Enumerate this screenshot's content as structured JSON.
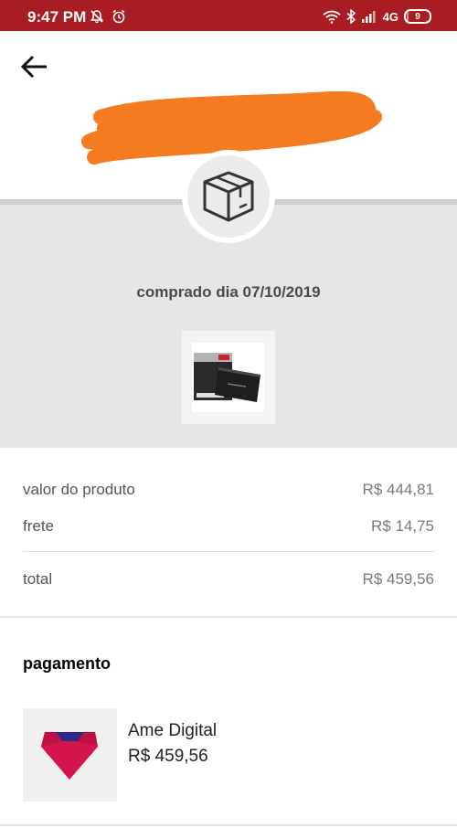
{
  "status_bar": {
    "time": "9:47 PM",
    "network": "4G",
    "battery_level": "9",
    "battery_fraction": 0.09,
    "color": "#a81c22",
    "icons": [
      "mute-notifications-icon",
      "alarm-icon",
      "wifi-icon",
      "bluetooth-icon",
      "signal-icon"
    ]
  },
  "header": {
    "back_icon": "back-arrow-icon",
    "redacted_color": "#f47b20"
  },
  "order": {
    "box_icon": "package-box-icon",
    "purchase_date": "comprado dia 07/10/2019",
    "band_color": "#e6e6e6"
  },
  "prices": {
    "product": {
      "label": "valor do produto",
      "value": "R$ 444,81"
    },
    "shipping": {
      "label": "frete",
      "value": "R$ 14,75"
    },
    "total": {
      "label": "total",
      "value": "R$ 459,56"
    }
  },
  "payment": {
    "title": "pagamento",
    "method": "Ame Digital",
    "amount": "R$ 459,56",
    "logo_colors": {
      "top": "#2a2a8c",
      "body": "#d4144d"
    }
  }
}
